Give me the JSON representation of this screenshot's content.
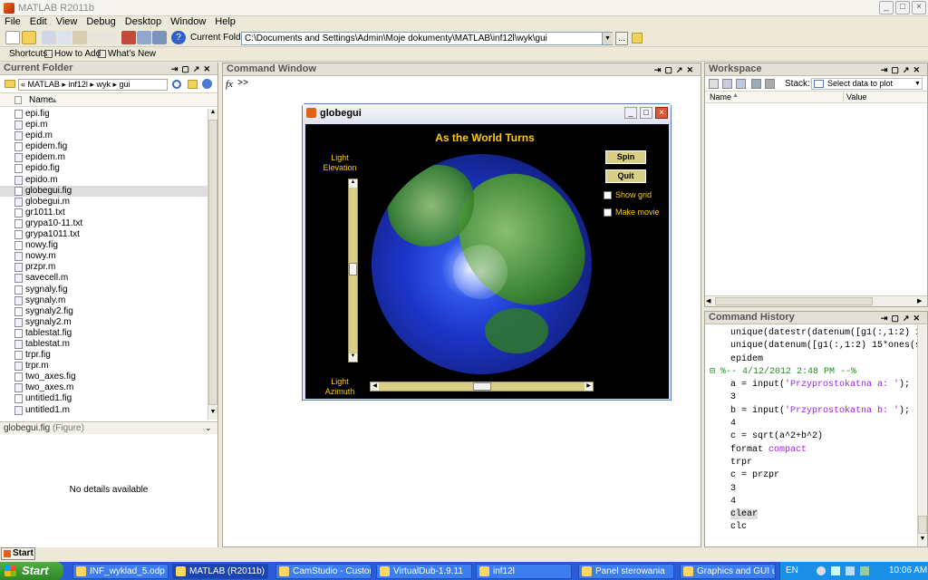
{
  "window": {
    "title": "MATLAB  R2011b"
  },
  "menu": [
    "File",
    "Edit",
    "View",
    "Debug",
    "Desktop",
    "Window",
    "Help"
  ],
  "toolbar": {
    "current_folder_label": "Current Folder:",
    "current_folder_path": "C:\\Documents and Settings\\Admin\\Moje dokumenty\\MATLAB\\inf12l\\wyk\\gui",
    "browse_label": "..."
  },
  "shortcuts": {
    "shortcuts_label": "Shortcuts",
    "how_to_add": "How to Add",
    "whats_new": "What's New"
  },
  "current_folder": {
    "title": "Current Folder",
    "breadcrumb": [
      "«",
      "MATLAB",
      "inf12l",
      "wyk",
      "gui"
    ],
    "column": "Name",
    "files": [
      "epi.fig",
      "epi.m",
      "epid.m",
      "epidem.fig",
      "epidem.m",
      "epido.fig",
      "epido.m",
      "globegui.fig",
      "globegui.m",
      "gr1011.txt",
      "grypa10-11.txt",
      "grypa1011.txt",
      "nowy.fig",
      "nowy.m",
      "przpr.m",
      "savecell.m",
      "sygnaly.fig",
      "sygnaly.m",
      "sygnaly2.fig",
      "sygnaly2.m",
      "tablestat.fig",
      "tablestat.m",
      "trpr.fig",
      "trpr.m",
      "two_axes.fig",
      "two_axes.m",
      "untitled1.fig",
      "untitled1.m"
    ],
    "selected": "globegui.fig",
    "details_title": "globegui.fig",
    "details_type": "(Figure)",
    "details_text": "No details available"
  },
  "command_window": {
    "title": "Command Window",
    "fx": "fx",
    "prompt": ">>"
  },
  "figure": {
    "title": "globegui",
    "heading": "As the World Turns",
    "light_elevation": "Light\nElevation",
    "light_azimuth": "Light\nAzimuth",
    "spin_label": "Spin",
    "quit_label": "Quit",
    "show_grid_label": "Show grid",
    "make_movie_label": "Make movie"
  },
  "workspace": {
    "title": "Workspace",
    "stack_label": "Stack:",
    "plot_select": "Select data to plot",
    "col_name": "Name",
    "col_value": "Value"
  },
  "command_history": {
    "title": "Command History",
    "lines": [
      {
        "t": "unique(datestr(datenum([g1(:,1:2) 15",
        "k": "code"
      },
      {
        "t": "unique(datenum([g1(:,1:2) 15*ones(si",
        "k": "code"
      },
      {
        "t": "epidem",
        "k": "code"
      },
      {
        "t": "%-- 4/12/2012 2:48 PM --%",
        "k": "session"
      },
      {
        "t": "a = input('Przyprostokatna a: ');",
        "k": "code",
        "str": "'Przyprostokatna a: '"
      },
      {
        "t": "3",
        "k": "code"
      },
      {
        "t": "b = input('Przyprostokatna b: ');",
        "k": "code",
        "str": "'Przyprostokatna b: '"
      },
      {
        "t": "4",
        "k": "code"
      },
      {
        "t": "c = sqrt(a^2+b^2)",
        "k": "code"
      },
      {
        "t": "format compact",
        "k": "code",
        "kw": "compact"
      },
      {
        "t": "trpr",
        "k": "code"
      },
      {
        "t": "c = przpr",
        "k": "code"
      },
      {
        "t": "3",
        "k": "code"
      },
      {
        "t": "4",
        "k": "code"
      },
      {
        "t": "clear",
        "k": "code",
        "sel": true
      },
      {
        "t": "clc",
        "k": "code"
      }
    ]
  },
  "status": {
    "start_label": "Start"
  },
  "taskbar": {
    "start": "Start",
    "tasks": [
      "INF_wyklad_5.odp - ...",
      "MATLAB (R2011b)",
      "CamStudio - Custom ...",
      "VirtualDub-1.9.11",
      "inf12l",
      "Panel sterowania",
      "Graphics and GUI usi..."
    ],
    "active": "MATLAB (R2011b)",
    "lang": "EN",
    "clock": "10:06 AM"
  },
  "colors": {
    "titlebar_text": "#8a8a8a",
    "figure_bg": "#000000",
    "heading": "#ffcc00",
    "button_bg": "#d9cf84",
    "taskbar": "#2a5bd8",
    "start": "#3c9a2f"
  }
}
